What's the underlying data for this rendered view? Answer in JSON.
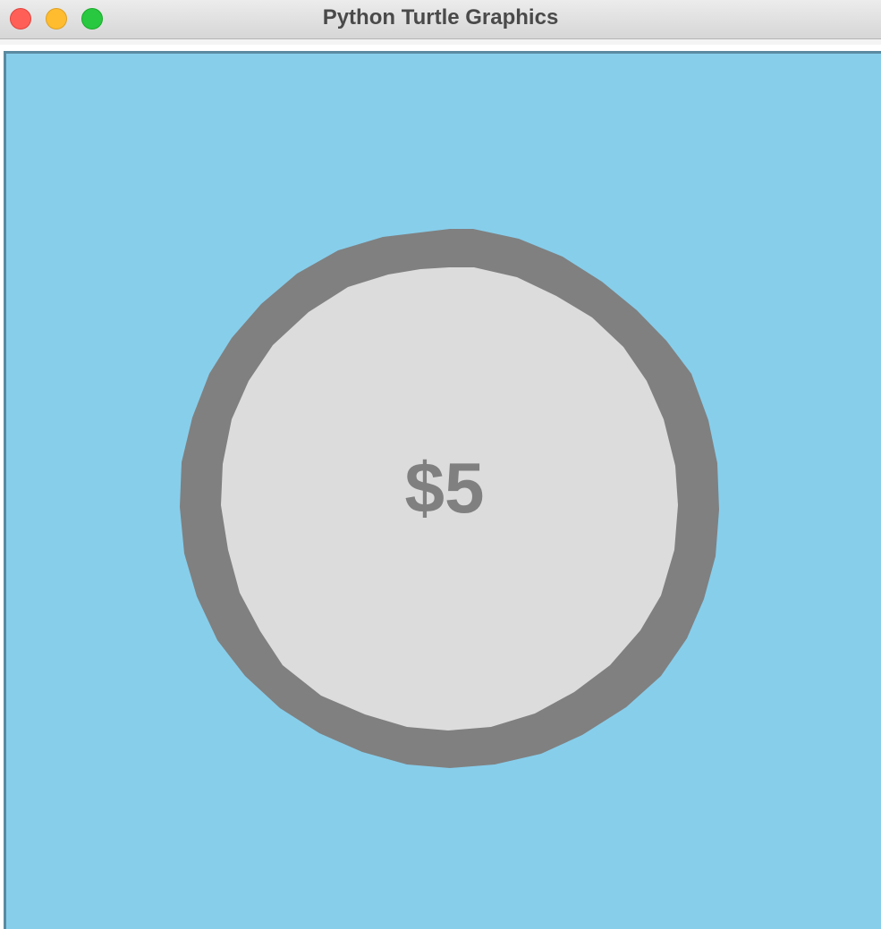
{
  "window": {
    "title": "Python Turtle Graphics",
    "controls": {
      "close": {
        "color": "#ff5f57"
      },
      "minimize": {
        "color": "#febc2e"
      },
      "zoom": {
        "color": "#28c840"
      }
    }
  },
  "canvas": {
    "background": "#87ceeb",
    "coin": {
      "label": "$5",
      "ring_color": "#808080",
      "face_color": "#dcdcdc",
      "label_color": "#808080"
    }
  }
}
